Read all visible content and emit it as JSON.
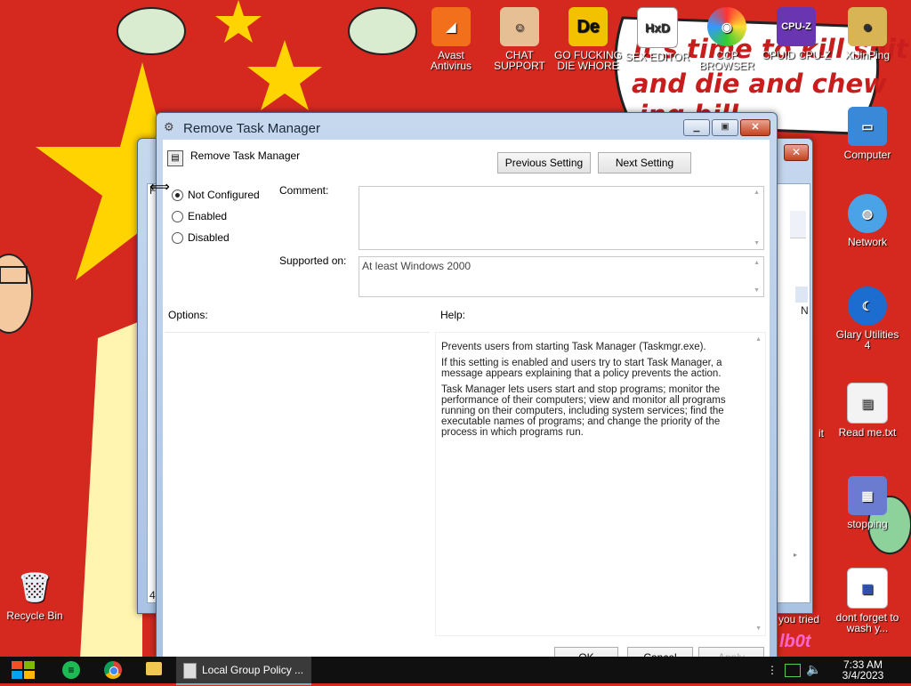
{
  "desktop": {
    "meme_text_lines": [
      "it's time to kill shit",
      "and die and chew",
      "ing bill"
    ],
    "icons_top": [
      {
        "name": "avast-antivirus",
        "label": "Avast Antivirus",
        "glyph": "◢",
        "color": "#f2701c"
      },
      {
        "name": "chat-support",
        "label": "CHAT SUPPORT",
        "glyph": "☺",
        "color": "#d9a070"
      },
      {
        "name": "go-die-whore",
        "label": "GO FUCKING DIE WHORE",
        "glyph": "De",
        "color": "#f2c200"
      },
      {
        "name": "sex-editor",
        "label": "SEX EDITOR",
        "glyph": "HxD",
        "color": "#ffffff"
      },
      {
        "name": "ccp-browser",
        "label": "CCP BROWSER",
        "glyph": "◉",
        "color": "#3f8de8"
      },
      {
        "name": "cpuid-cpuz",
        "label": "CPUID CPU-Z",
        "glyph": "CPU-Z",
        "color": "#6a35b0"
      },
      {
        "name": "xiunping",
        "label": "XiJinPing",
        "glyph": "☻",
        "color": "#d8b455"
      }
    ],
    "icons_right": [
      {
        "name": "computer",
        "label": "Computer",
        "glyph": "▭",
        "color": "#3a88d8"
      },
      {
        "name": "network",
        "label": "Network",
        "glyph": "◍",
        "color": "#4aa3e6"
      },
      {
        "name": "glary-utilities",
        "label": "Glary Utilities 4",
        "glyph": "☾",
        "color": "#1d6ccf"
      },
      {
        "name": "read-me-txt",
        "label": "Read me.txt",
        "glyph": "▤",
        "color": "#f3f3f3"
      },
      {
        "name": "stopping",
        "label": "stopping",
        "glyph": "▦",
        "color": "#6a7bd0"
      },
      {
        "name": "dont-forget",
        "label": "dont forget to wash y...",
        "glyph": "▦",
        "color": "#ffffff"
      }
    ],
    "partial_right_labels": [
      "it",
      "you tried",
      "lb0t"
    ],
    "recycle_bin": {
      "label": "Recycle Bin",
      "glyph": "🗑"
    }
  },
  "back_window": {
    "status_letters": [
      "N",
      "N"
    ],
    "left_fragments": [
      "F",
      "4"
    ]
  },
  "dialog": {
    "title": "Remove Task Manager",
    "header_title": "Remove Task Manager",
    "previous_setting": "Previous Setting",
    "next_setting": "Next Setting",
    "state_options": [
      {
        "label": "Not Configured",
        "selected": true
      },
      {
        "label": "Enabled",
        "selected": false
      },
      {
        "label": "Disabled",
        "selected": false
      }
    ],
    "comment_label": "Comment:",
    "supported_label": "Supported on:",
    "supported_value": "At least Windows 2000",
    "options_label": "Options:",
    "help_label": "Help:",
    "help_paragraphs": [
      "Prevents users from starting Task Manager (Taskmgr.exe).",
      "If this setting is enabled and users try to start Task Manager, a message appears explaining that a policy prevents the action.",
      "Task Manager lets users start and stop programs; monitor the performance of their computers; view and monitor all programs running on their computers, including system services; find the executable names of programs; and change the priority of the process in which programs run."
    ],
    "ok_label": "OK",
    "cancel_label": "Cancel",
    "apply_label": "Apply"
  },
  "taskbar": {
    "active_task_label": "Local Group Policy ...",
    "time": "7:33 AM",
    "date": "3/4/2023"
  }
}
